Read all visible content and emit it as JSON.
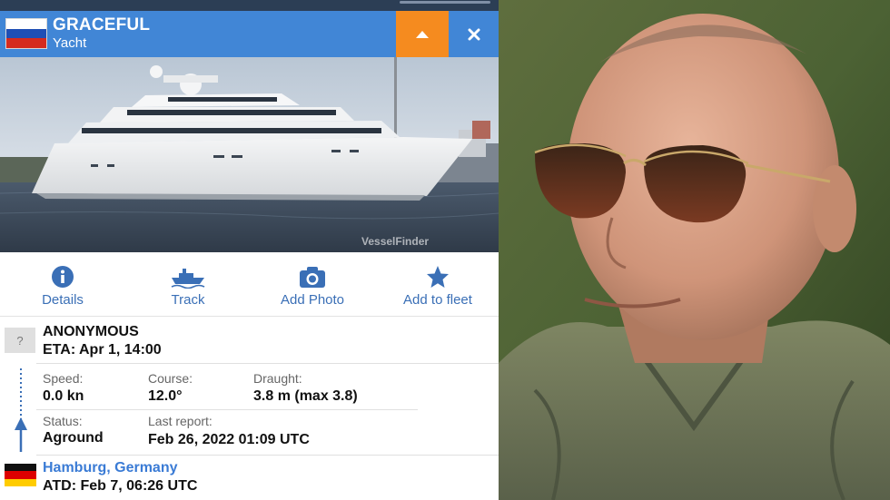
{
  "vessel": {
    "name": "GRACEFUL",
    "type": "Yacht",
    "flag": "russia-flag"
  },
  "photo": {
    "watermark": "VesselFinder"
  },
  "actions": [
    {
      "label": "Details",
      "icon": "info-icon"
    },
    {
      "label": "Track",
      "icon": "ship-track-icon"
    },
    {
      "label": "Add Photo",
      "icon": "camera-icon"
    },
    {
      "label": "Add to fleet",
      "icon": "star-icon"
    }
  ],
  "destination": {
    "placeholder_icon": "?",
    "name": "ANONYMOUS",
    "eta": "ETA: Apr 1, 14:00"
  },
  "stats": {
    "speed_label": "Speed:",
    "speed_value": "0.0 kn",
    "course_label": "Course:",
    "course_value": "12.0°",
    "draught_label": "Draught:",
    "draught_value": "3.8 m (max 3.8)",
    "status_label": "Status:",
    "status_value": "Aground",
    "last_report_label": "Last report:",
    "last_report_value": "Feb 26, 2022 01:09 UTC"
  },
  "departure": {
    "flag": "germany-flag",
    "port": "Hamburg, Germany",
    "atd": "ATD: Feb 7, 06:26 UTC"
  },
  "colors": {
    "header_blue": "#4186d6",
    "accent_orange": "#f58b1f",
    "link_blue": "#3a7bd5"
  }
}
